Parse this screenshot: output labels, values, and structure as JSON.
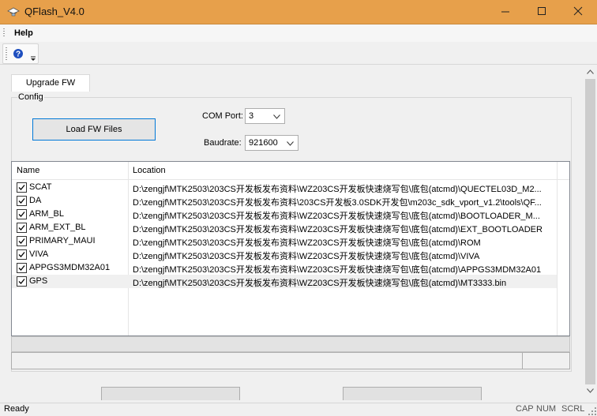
{
  "window": {
    "title": "QFlash_V4.0"
  },
  "menu": {
    "items": [
      "Help"
    ]
  },
  "toolbar": {
    "help_icon": "help-icon",
    "dropdown_icon": "chevron-down-icon"
  },
  "tabs": [
    {
      "label": "Upgrade FW",
      "active": true
    }
  ],
  "config": {
    "legend": "Config",
    "load_button": "Load FW Files",
    "com_port_label": "COM Port:",
    "com_port_value": "3",
    "baudrate_label": "Baudrate:",
    "baudrate_value": "921600"
  },
  "table": {
    "columns": [
      "Name",
      "Location"
    ],
    "rows": [
      {
        "name": "SCAT",
        "checked": true,
        "location": "D:\\zengjf\\MTK2503\\203CS开发板发布资料\\WZ203CS开发板快速烧写包\\底包(atcmd)\\QUECTEL03D_M2..."
      },
      {
        "name": "DA",
        "checked": true,
        "location": "D:\\zengjf\\MTK2503\\203CS开发板发布资料\\203CS开发板3.0SDK开发包\\m203c_sdk_vport_v1.2\\tools\\QF..."
      },
      {
        "name": "ARM_BL",
        "checked": true,
        "location": "D:\\zengjf\\MTK2503\\203CS开发板发布资料\\WZ203CS开发板快速烧写包\\底包(atcmd)\\BOOTLOADER_M..."
      },
      {
        "name": "ARM_EXT_BL",
        "checked": true,
        "location": "D:\\zengjf\\MTK2503\\203CS开发板发布资料\\WZ203CS开发板快速烧写包\\底包(atcmd)\\EXT_BOOTLOADER"
      },
      {
        "name": "PRIMARY_MAUI",
        "checked": true,
        "location": "D:\\zengjf\\MTK2503\\203CS开发板发布资料\\WZ203CS开发板快速烧写包\\底包(atcmd)\\ROM"
      },
      {
        "name": "VIVA",
        "checked": true,
        "location": "D:\\zengjf\\MTK2503\\203CS开发板发布资料\\WZ203CS开发板快速烧写包\\底包(atcmd)\\VIVA"
      },
      {
        "name": "APPGS3MDM32A01",
        "checked": true,
        "location": "D:\\zengjf\\MTK2503\\203CS开发板发布资料\\WZ203CS开发板快速烧写包\\底包(atcmd)\\APPGS3MDM32A01"
      },
      {
        "name": "GPS",
        "checked": true,
        "location": "D:\\zengjf\\MTK2503\\203CS开发板发布资料\\WZ203CS开发板快速烧写包\\底包(atcmd)\\MT3333.bin",
        "selected": true
      }
    ]
  },
  "status": {
    "text": "Ready",
    "indicators": [
      "CAP",
      "NUM",
      "SCRL"
    ]
  },
  "colors": {
    "titlebar": "#e7a04b",
    "focus_border": "#0078d7"
  }
}
